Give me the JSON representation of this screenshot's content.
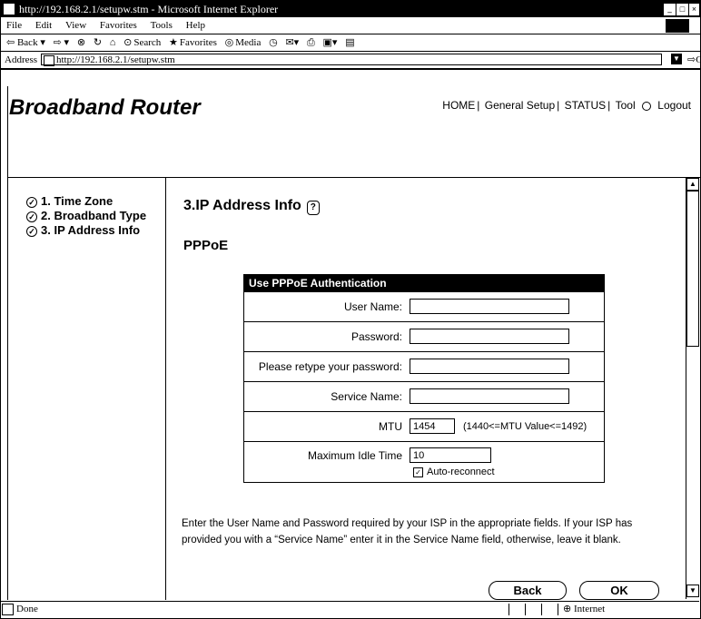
{
  "window": {
    "title": "http://192.168.2.1/setupw.stm - Microsoft Internet Explorer"
  },
  "menu": [
    "File",
    "Edit",
    "View",
    "Favorites",
    "Tools",
    "Help"
  ],
  "toolbar": {
    "back": "⇦ Back ▾",
    "forward": "⇨ ▾",
    "stop": "⊗",
    "refresh": "↻",
    "home": "⌂",
    "search": "Search",
    "favorites": "Favorites",
    "media": "Media"
  },
  "address": {
    "label": "Address",
    "url": "http://192.168.2.1/setupw.stm",
    "go": "Go"
  },
  "header": {
    "brand": "Broadband Router",
    "nav": [
      "HOME",
      "General Setup",
      "STATUS",
      "Tool",
      "Logout"
    ]
  },
  "sidebar": {
    "items": [
      "1. Time Zone",
      "2. Broadband Type",
      "3. IP Address Info"
    ]
  },
  "main": {
    "title": "3.IP Address Info",
    "subtitle": "PPPoE",
    "form_title": "Use PPPoE Authentication",
    "fields": {
      "user_name": {
        "label": "User Name:",
        "value": ""
      },
      "password": {
        "label": "Password:",
        "value": ""
      },
      "retype": {
        "label": "Please retype your password:",
        "value": ""
      },
      "service": {
        "label": "Service Name:",
        "value": ""
      },
      "mtu": {
        "label": "MTU",
        "value": "1454",
        "hint": "(1440<=MTU Value<=1492)"
      },
      "idle": {
        "label": "Maximum Idle Time",
        "value": "10"
      },
      "auto_reconnect": {
        "label": "Auto-reconnect",
        "checked": true
      }
    },
    "description": "Enter the User Name and Password required by your ISP in the appropriate fields. If your ISP has provided you with a “Service Name” enter it in the Service Name field, otherwise, leave it blank.",
    "buttons": {
      "back": "Back",
      "ok": "OK"
    }
  },
  "status": {
    "text": "Done",
    "zone": "Internet"
  }
}
